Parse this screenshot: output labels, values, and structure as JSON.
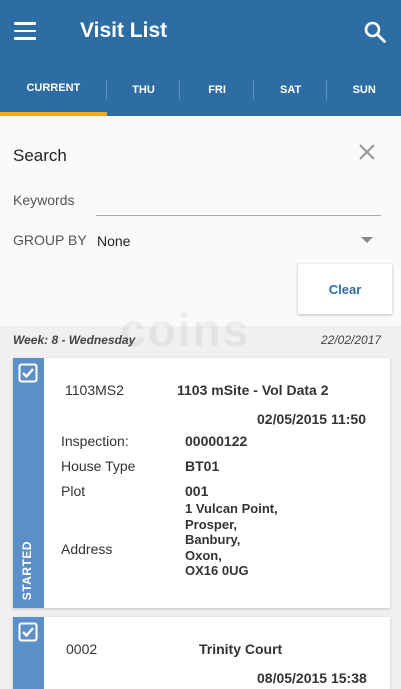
{
  "header": {
    "title": "Visit List",
    "menu_icon": "menu-icon",
    "search_icon": "search-icon"
  },
  "tabs": [
    {
      "label": "CURRENT",
      "active": true
    },
    {
      "label": "THU",
      "active": false
    },
    {
      "label": "FRI",
      "active": false
    },
    {
      "label": "SAT",
      "active": false
    },
    {
      "label": "SUN",
      "active": false
    }
  ],
  "search": {
    "title": "Search",
    "keywords_label": "Keywords",
    "keywords_value": "",
    "group_by_label": "GROUP BY",
    "group_by_value": "None",
    "clear_label": "Clear"
  },
  "watermark": "coins",
  "week": {
    "label": "Week: 8 - Wednesday",
    "date": "22/02/2017"
  },
  "visits": [
    {
      "code": "1103MS2",
      "site": "1103 mSite - Vol Data 2",
      "datetime": "02/05/2015 11:50",
      "inspection_label": "Inspection:",
      "inspection": "00000122",
      "house_type_label": "House Type",
      "house_type": "BT01",
      "plot_label": "Plot",
      "plot": "001",
      "address_label": "Address",
      "address": [
        "1 Vulcan Point,",
        "Prosper,",
        "Banbury,",
        "Oxon,",
        "OX16 0UG"
      ],
      "status": "STARTED"
    },
    {
      "code": "0002",
      "site": "Trinity Court",
      "datetime": "08/05/2015 15:38"
    }
  ],
  "colors": {
    "primary": "#2e6da4",
    "accent": "#f5a623",
    "status_bar": "#5b8fc7"
  }
}
